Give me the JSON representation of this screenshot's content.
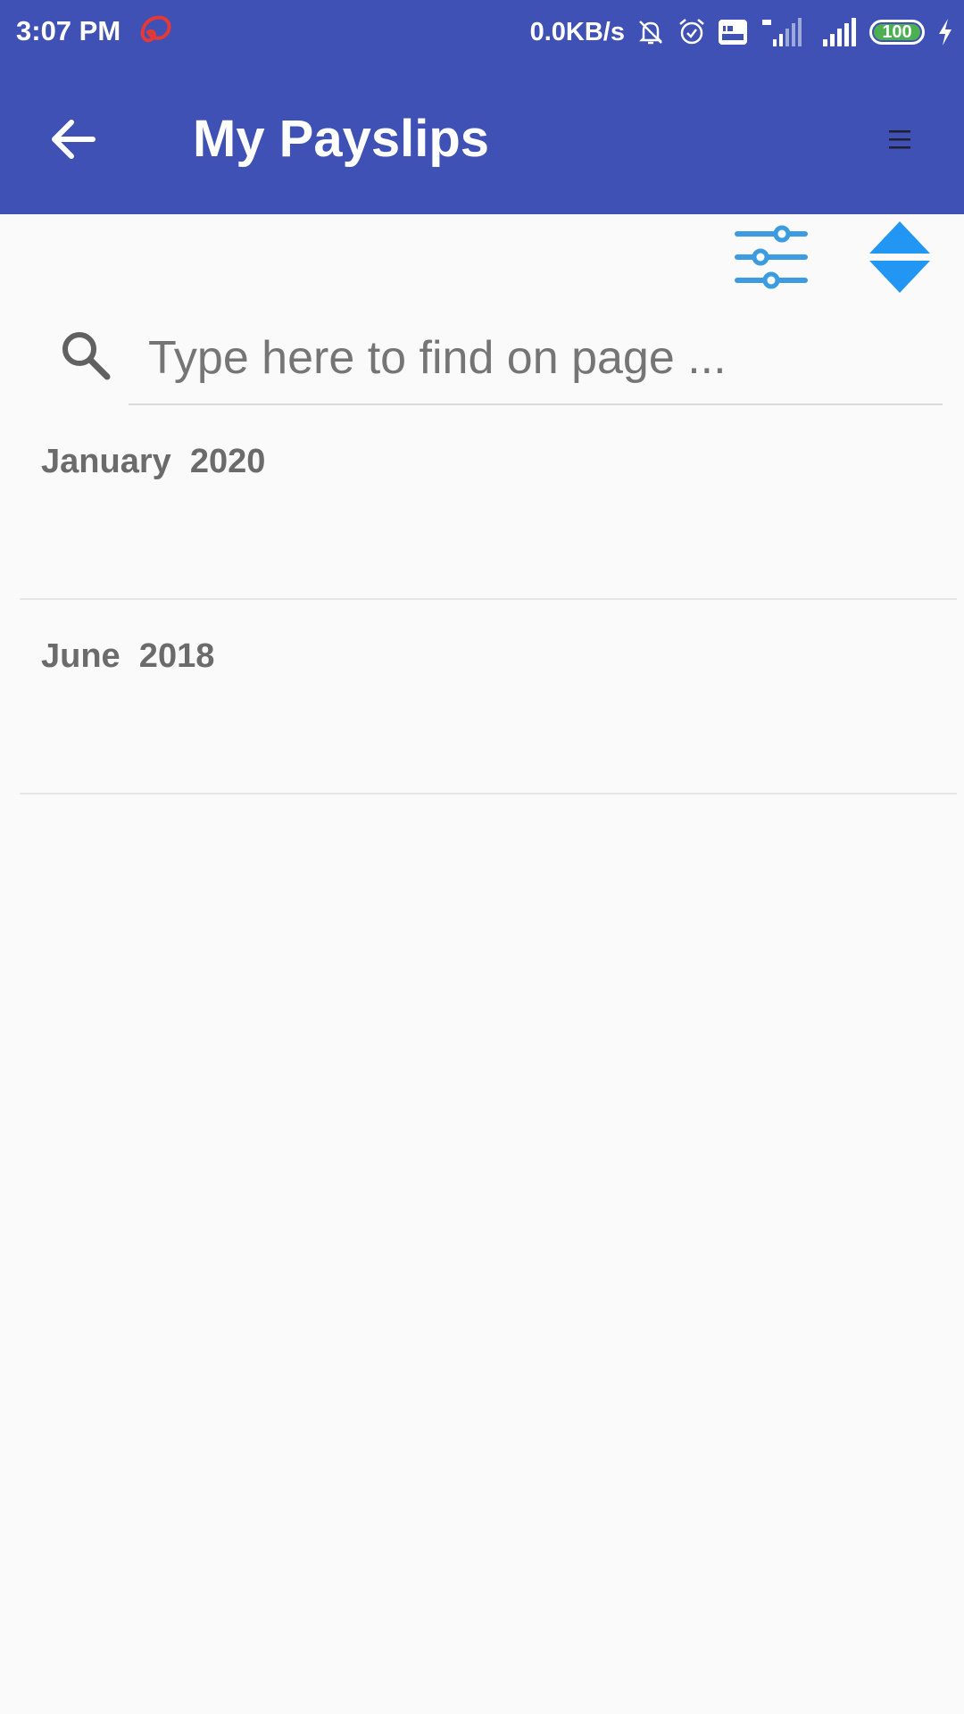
{
  "status_bar": {
    "time": "3:07 PM",
    "network_speed": "0.0KB/s",
    "battery_level": "100",
    "icons": [
      "carrier-icon",
      "mute-bell-icon",
      "alarm-icon",
      "volte-icon",
      "signal-4g-icon",
      "signal-icon",
      "battery-icon",
      "charging-icon"
    ]
  },
  "app_bar": {
    "title": "My Payslips",
    "back_icon": "arrow-left-icon",
    "menu_icon": "hamburger-menu-icon"
  },
  "toolbar": {
    "filter_icon": "sliders-filter-icon",
    "sort_icon": "sort-up-down-icon"
  },
  "search": {
    "placeholder": "Type here to find on page ...",
    "value": ""
  },
  "payslips": [
    {
      "label": "January  2020"
    },
    {
      "label": "June  2018"
    }
  ],
  "colors": {
    "primary": "#3F51B5",
    "accent": "#2196F3",
    "background": "#FAFAFA",
    "list_text": "#6B6B6B",
    "battery": "#4CAF50"
  }
}
